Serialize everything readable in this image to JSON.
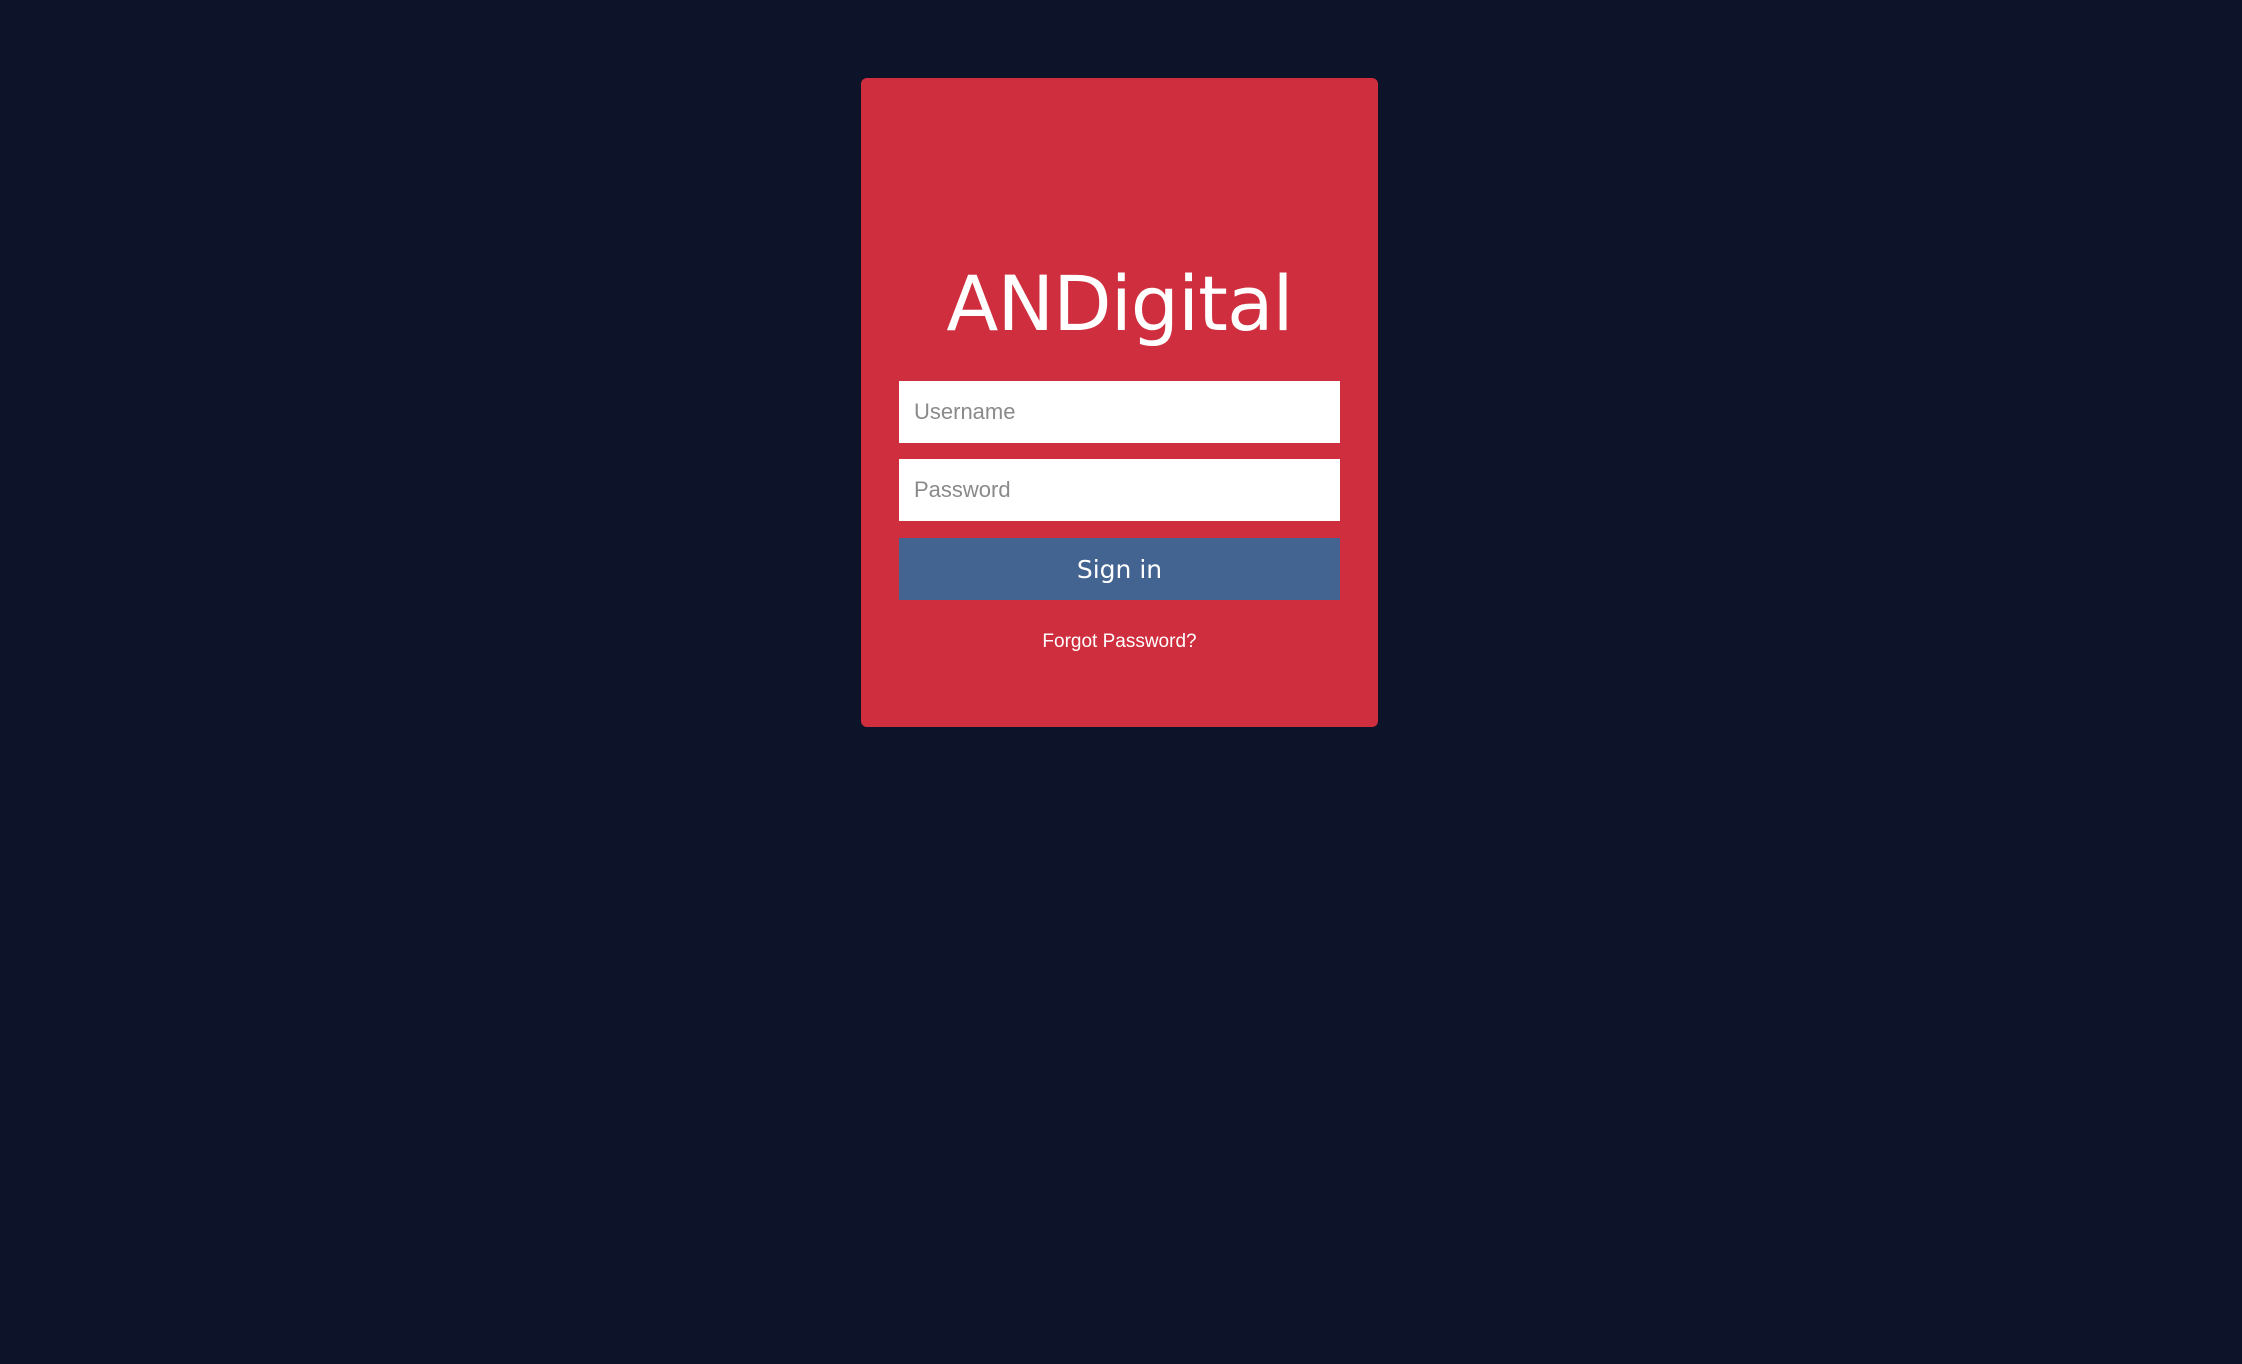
{
  "brand": {
    "logo_text": "ANDigital"
  },
  "login": {
    "username_placeholder": "Username",
    "username_value": "",
    "password_placeholder": "Password",
    "password_value": "",
    "signin_label": "Sign in",
    "forgot_password_label": "Forgot Password?"
  },
  "colors": {
    "background": "#0d1329",
    "card": "#cf2e3e",
    "button": "#436390",
    "text": "#ffffff"
  }
}
